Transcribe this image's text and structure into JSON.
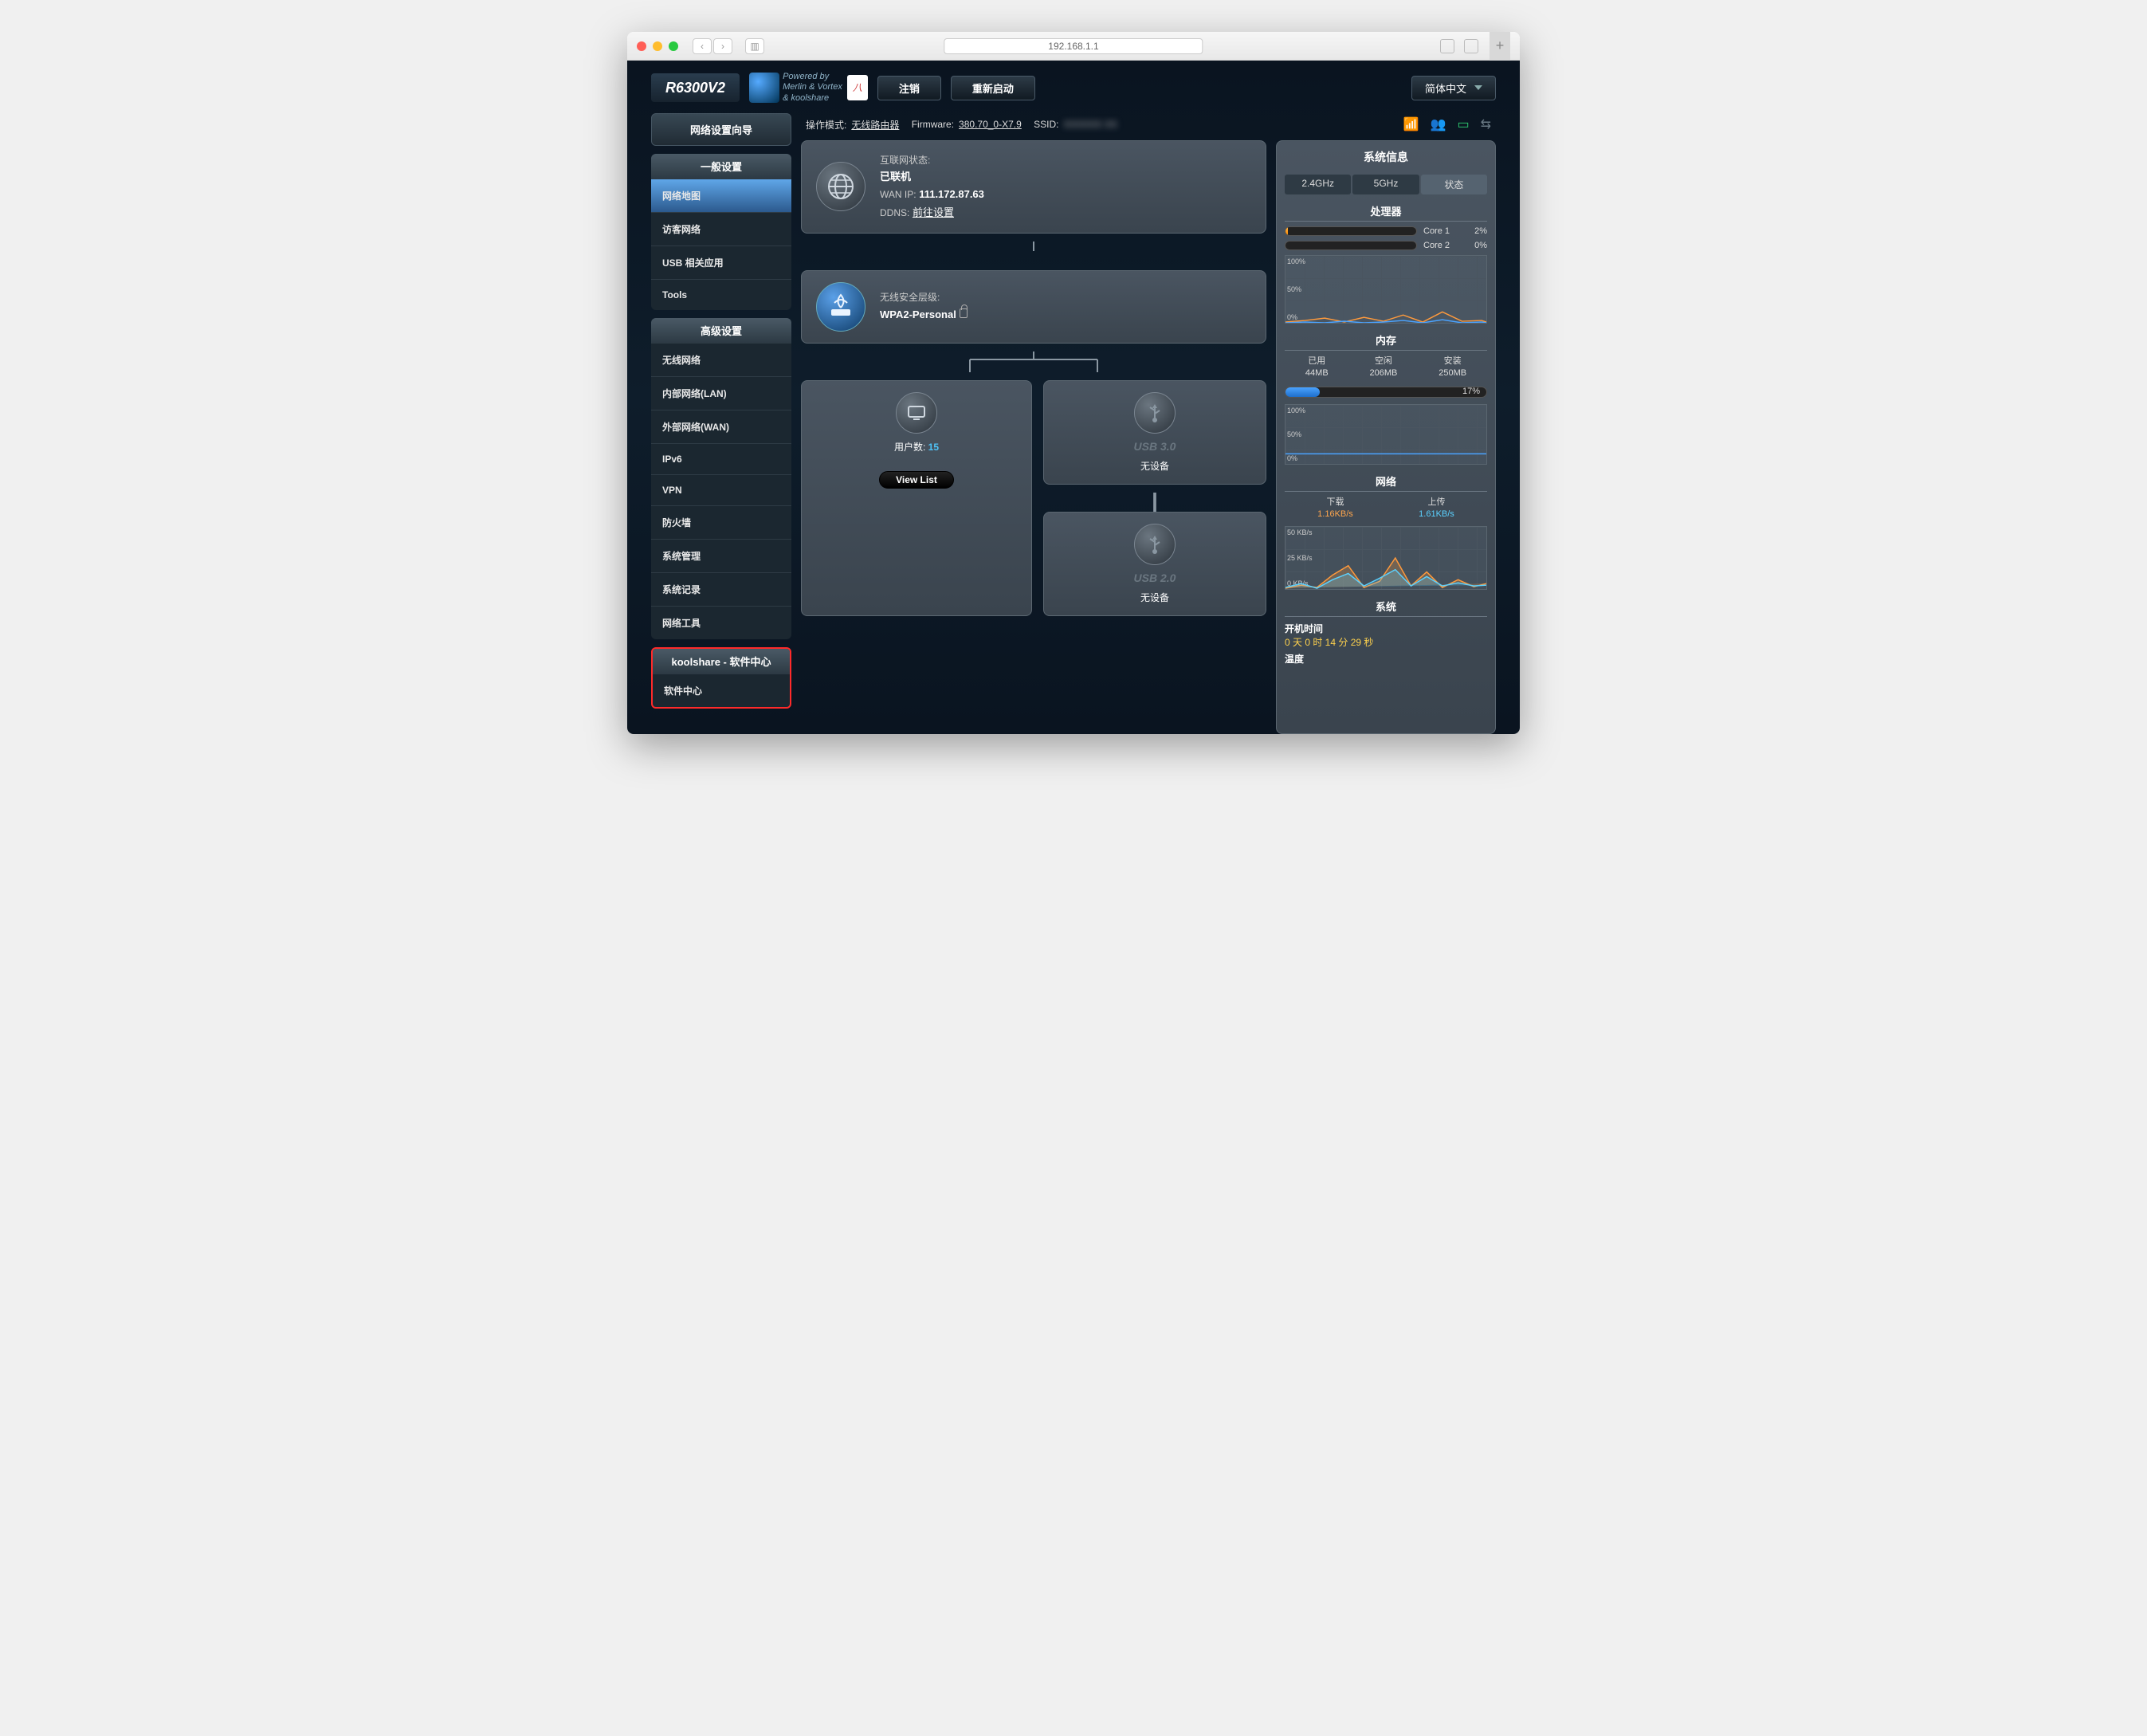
{
  "browser": {
    "url": "192.168.1.1"
  },
  "header": {
    "model": "R6300V2",
    "powered_line1": "Powered by",
    "powered_line2": "Merlin & Vortex",
    "powered_line3": "& koolshare",
    "logout": "注销",
    "reboot": "重新启动",
    "language": "简体中文"
  },
  "statusbar": {
    "mode_label": "操作模式:",
    "mode_value": "无线路由器",
    "fw_label": "Firmware:",
    "fw_value": "380.70_0-X7.9",
    "ssid_label": "SSID:"
  },
  "sidebar": {
    "wizard": "网络设置向导",
    "general": {
      "title": "一般设置",
      "items": [
        "网络地图",
        "访客网络",
        "USB 相关应用",
        "Tools"
      ]
    },
    "advanced": {
      "title": "高级设置",
      "items": [
        "无线网络",
        "内部网络(LAN)",
        "外部网络(WAN)",
        "IPv6",
        "VPN",
        "防火墙",
        "系统管理",
        "系统记录",
        "网络工具"
      ]
    },
    "koolshare": {
      "title": "koolshare - 软件中心",
      "items": [
        "软件中心"
      ]
    }
  },
  "internetCard": {
    "title": "互联网状态:",
    "status": "已联机",
    "wan_label": "WAN IP:",
    "wan_ip": "111.172.87.63",
    "ddns_label": "DDNS:",
    "ddns_link": "前往设置"
  },
  "wifiCard": {
    "title": "无线安全层级:",
    "mode": "WPA2-Personal"
  },
  "clientsCard": {
    "label": "用户数:",
    "count": "15",
    "btn": "View List"
  },
  "usb": {
    "u3": "USB 3.0",
    "u2": "USB 2.0",
    "none": "无设备"
  },
  "sysinfo": {
    "title": "系统信息",
    "tabs": [
      "2.4GHz",
      "5GHz",
      "状态"
    ],
    "cpu": {
      "title": "处理器",
      "cores": [
        {
          "name": "Core 1",
          "pct": "2%",
          "fill": 2
        },
        {
          "name": "Core 2",
          "pct": "0%",
          "fill": 0
        }
      ],
      "ylabels": [
        "100%",
        "50%",
        "0%"
      ]
    },
    "mem": {
      "title": "内存",
      "used_label": "已用",
      "used": "44MB",
      "free_label": "空闲",
      "free": "206MB",
      "total_label": "安装",
      "total": "250MB",
      "pct": "17%",
      "fill": 17,
      "ylabels": [
        "100%",
        "50%",
        "0%"
      ]
    },
    "net": {
      "title": "网络",
      "dl_label": "下载",
      "dl": "1.16KB/s",
      "ul_label": "上传",
      "ul": "1.61KB/s",
      "ylabels": [
        "50 KB/s",
        "25 KB/s",
        "0 KB/s"
      ]
    },
    "sys": {
      "title": "系统",
      "uptime_label": "开机时间",
      "uptime": "0 天 0 时 14 分 29 秒",
      "temp_label": "温度"
    }
  },
  "chart_data": {
    "type": "line",
    "charts": [
      {
        "id": "cpu",
        "series": [
          {
            "name": "Core 1",
            "values": [
              3,
              2,
              4,
              1,
              5,
              2,
              6,
              1,
              9,
              2,
              3,
              1
            ]
          },
          {
            "name": "Core 2",
            "values": [
              0,
              1,
              0,
              2,
              0,
              1,
              3,
              0,
              4,
              0,
              1,
              0
            ]
          }
        ],
        "ylim": [
          0,
          100
        ],
        "ylabel": "%"
      },
      {
        "id": "mem",
        "series": [
          {
            "name": "used",
            "values": [
              17,
              17,
              17,
              17,
              17,
              17,
              17,
              17,
              17,
              17,
              17,
              17
            ]
          }
        ],
        "ylim": [
          0,
          100
        ],
        "ylabel": "%"
      },
      {
        "id": "net",
        "series": [
          {
            "name": "download",
            "values": [
              0,
              2,
              1,
              8,
              15,
              1,
              4,
              22,
              3,
              10,
              1,
              5
            ]
          },
          {
            "name": "upload",
            "values": [
              1,
              3,
              0,
              5,
              9,
              2,
              6,
              12,
              2,
              7,
              2,
              3
            ]
          }
        ],
        "ylim": [
          0,
          50
        ],
        "ylabel": "KB/s"
      }
    ]
  }
}
